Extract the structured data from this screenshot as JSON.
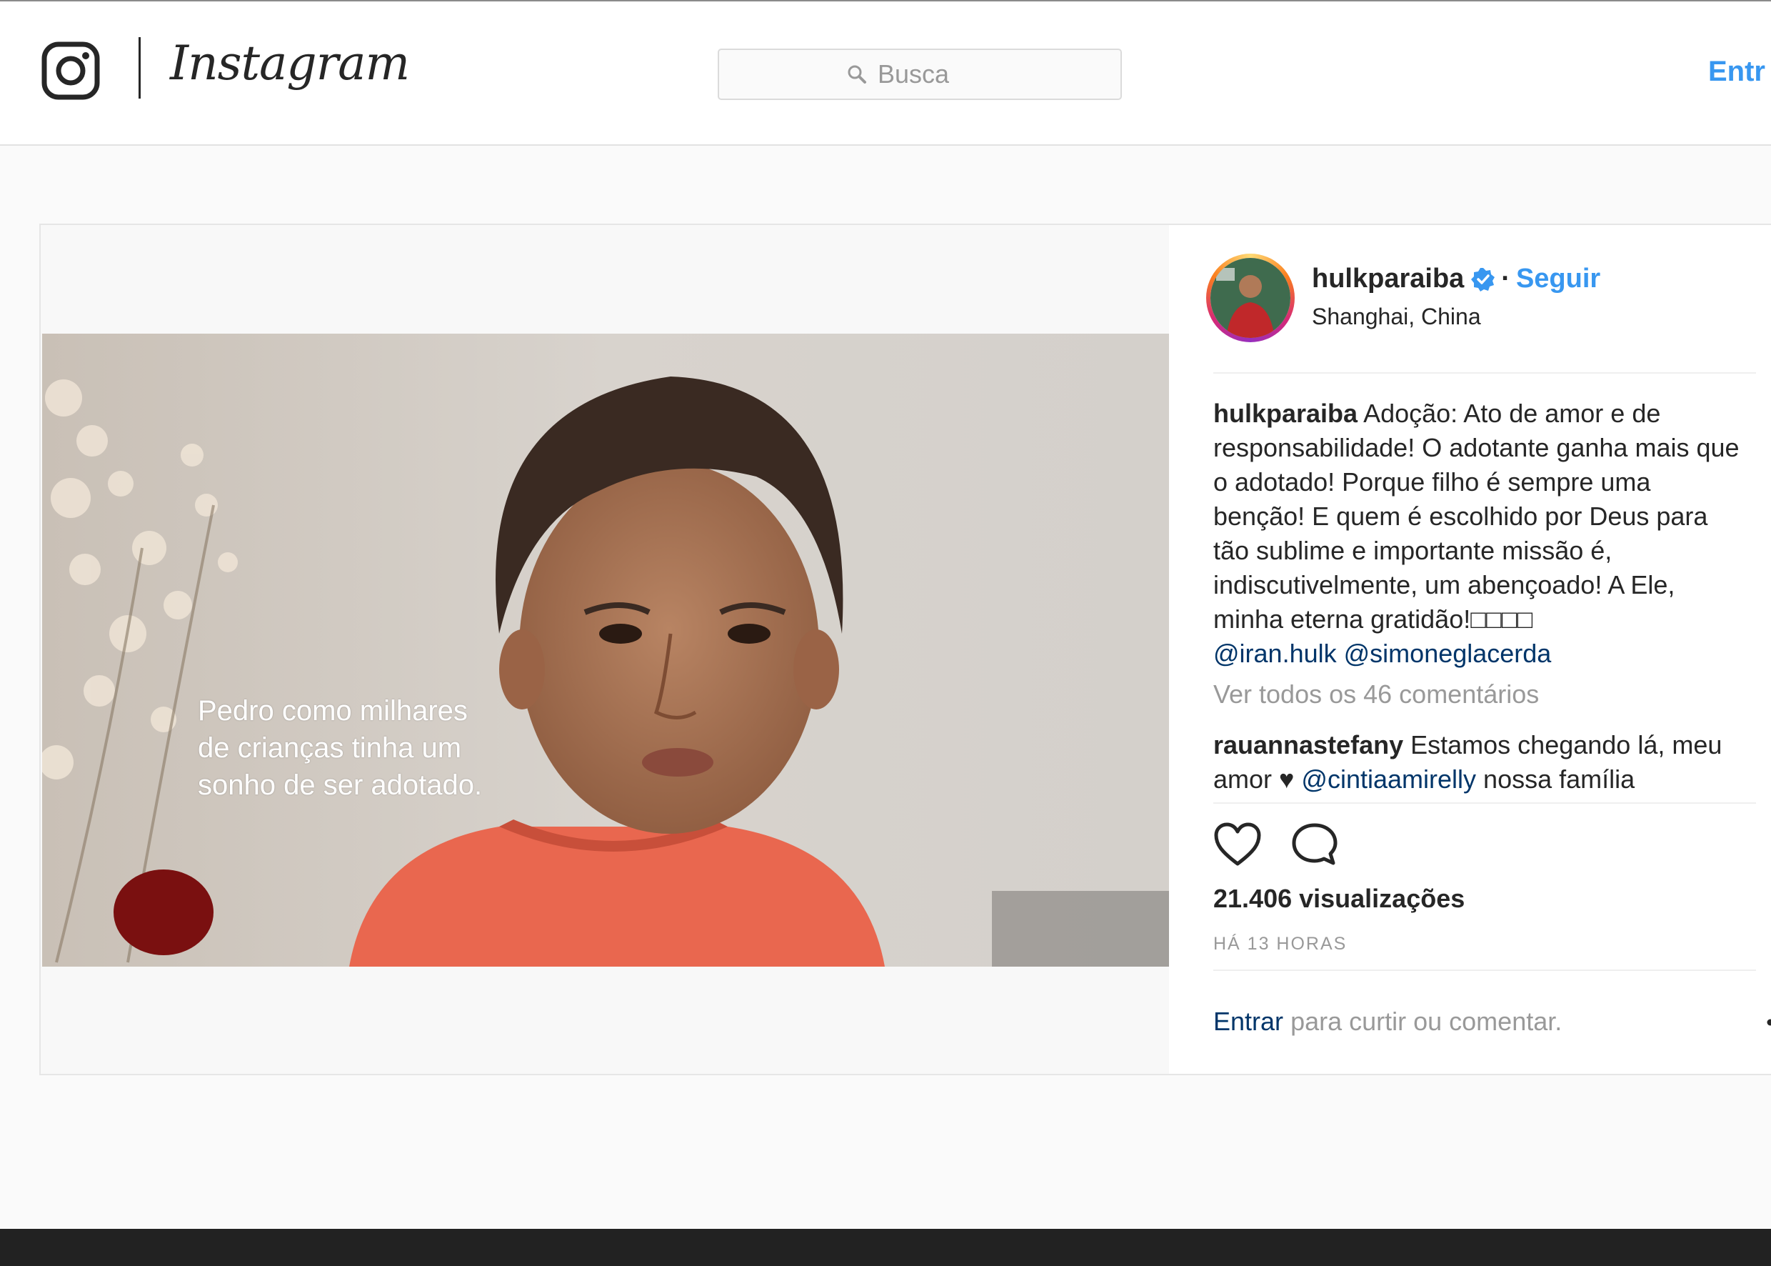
{
  "header": {
    "brand": "Instagram",
    "search_placeholder": "Busca",
    "login_label": "Entr"
  },
  "post": {
    "subtitle_lines": [
      "Pedro como milhares",
      "de crianças tinha um",
      "sonho de ser adotado."
    ],
    "username": "hulkparaiba",
    "follow_label": "Seguir",
    "location": "Shanghai, China",
    "caption_username": "hulkparaiba",
    "caption_text": "Adoção: Ato de amor e de responsabilidade! O adotante ganha mais que o adotado! Porque filho é sempre uma benção! E quem é escolhido por Deus para tão sublime e importante missão é, indiscutivelmente, um abençoado! A Ele, minha eterna gratidão!□□□□",
    "caption_mentions": [
      "@iran.hulk",
      "@simoneglacerda"
    ],
    "view_all_comments": "Ver todos os 46 comentários",
    "comment": {
      "username": "rauannastefany",
      "text_before": "Estamos chegando lá, meu amor ♥",
      "mention": "@cintiaamirelly",
      "text_after": "nossa família"
    },
    "views": "21.406 visualizações",
    "time": "HÁ 13 HORAS",
    "signin_link": "Entrar",
    "signin_text": "para curtir ou comentar."
  },
  "icons": {
    "logo": "instagram-camera-icon",
    "search": "search-icon",
    "verified": "verified-badge-icon",
    "like": "heart-icon",
    "comment": "comment-bubble-icon",
    "more": "more-options-icon"
  },
  "colors": {
    "link_blue": "#3897f0",
    "mention_blue": "#003569",
    "text": "#262626",
    "muted": "#999999",
    "background": "#fafafa",
    "footer": "#222222"
  }
}
